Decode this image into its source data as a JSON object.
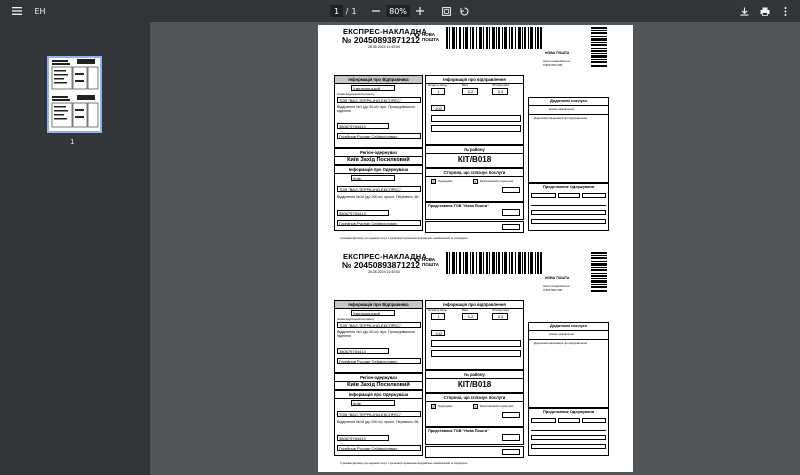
{
  "toolbar": {
    "menu_icon": "menu-icon",
    "title": "ЕН",
    "page_current": "1",
    "page_sep": "/",
    "page_total": "1",
    "zoom": "80%",
    "icons": [
      "minus-icon",
      "plus-icon",
      "fit-page-icon",
      "rotate-icon",
      "download-icon",
      "print-icon",
      "more-vert-icon"
    ]
  },
  "sidebar": {
    "thumb_label": "1"
  },
  "waybill": {
    "title": "ЕКСПРЕС-НАКЛАДНА",
    "number": "№ 20450893871212",
    "date": "28.05.2024 11:40:54",
    "brand_line1": "НОВА",
    "brand_line2": "ПОШТА",
    "np_title": "НОВА ПОШТА",
    "np_site": "www.novaposhta.ua",
    "np_phone": "0 800 500 609",
    "sender_header": "Інформація про Відправника",
    "sender_city": "Хмельницький",
    "sender_small_1": "Назва відділення/поштомату",
    "sender_company": "ТОВ \"ВАЛ-ТЕРРА-ІНД-ЕКСПРЕС\"",
    "sender_address": "Відділення №1 (до 30 кг): вул. Проскурівського підпілля",
    "sender_phone": "380679754413",
    "sender_name": "Гусейнов Руслан Сейфуллович",
    "region_header": "Регіон-одержувач",
    "region_value": "Київ Захід Посилковий",
    "recipient_header": "Інформація про Одержувача",
    "recipient_city": "Київ",
    "recipient_company": "ТОВ \"ВАЛ-ТЕРРА-ІНД-ЕКСПРЕС\"",
    "recipient_address": "Відділення №18 (до 200 кг): просп. Перемоги, 66",
    "recipient_phone": "380679754413",
    "recipient_name": "Гусейнов Руслан Сейфуллович",
    "dispatch_header": "Інформація про відправлення",
    "seats_label": "Кількість місць",
    "seats_value": "1",
    "weight_label": "Вага",
    "weight_value": "0.2",
    "volume_label": "Об'ємна вага",
    "volume_value": "0.3",
    "declared_value": "100",
    "area_header": "№ району",
    "area_value": "КІТ/В018",
    "payer_header": "Сторона, що сплачує послуги",
    "payer_recipient": "Одержувач",
    "payer_cashless": "Безготівковий розрахунок",
    "payer_mark": "X",
    "np_rep_header": "Представник ТОВ \"Нова Пошта\"",
    "additional_header": "Додаткові послуги",
    "additional_note": "Номер замовлення",
    "additional_info": "Додаткова інформація про відправлення",
    "recipient_rep_header": "Представник Одержувача",
    "footer_note": "З умовами Договору про надання послуг з організації перевезення відправлень ознайомлений та погоджуюсь"
  }
}
